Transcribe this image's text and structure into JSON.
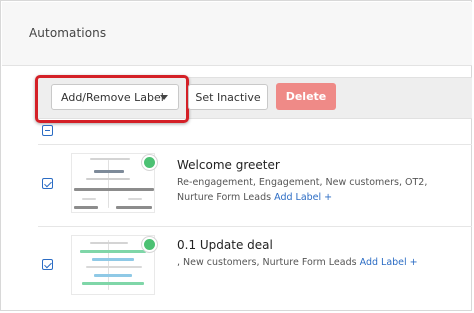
{
  "header": {
    "title": "Automations"
  },
  "toolbar": {
    "label_dropdown": "Add/Remove Label",
    "set_inactive": "Set Inactive",
    "delete": "Delete"
  },
  "colors": {
    "highlight": "#d42027",
    "delete_bg": "#ef8a87",
    "link": "#2b6cc4",
    "active_dot": "#4cc173"
  },
  "automations": [
    {
      "title": "Welcome greeter",
      "labels_line1": "Re-engagement, Engagement, New customers, OT2,",
      "labels_line2": "Nurture Form Leads",
      "add_label": "Add Label +",
      "selected": true,
      "status": "active"
    },
    {
      "title": "0.1 Update deal",
      "labels_line1": ", New customers, Nurture Form Leads",
      "add_label": "Add Label +",
      "selected": true,
      "status": "active"
    }
  ],
  "icons": {
    "dropdown": "caret-down-icon",
    "select_all": "checkbox-indeterminate-icon",
    "row_check": "checkbox-checked-icon",
    "status": "active-status-dot"
  }
}
